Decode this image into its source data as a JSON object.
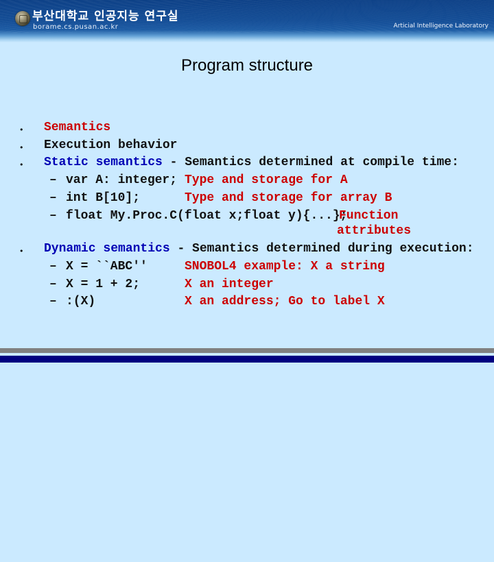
{
  "header": {
    "institution": "부산대학교 인공지능 연구실",
    "url": "borame.cs.pusan.ac.kr",
    "lab_name": "Articial Intelligence Laboratory",
    "emblem_icon": "university-seal-icon"
  },
  "slide": {
    "title": "Program structure",
    "bullets": [
      {
        "parts": [
          {
            "text": "Semantics",
            "color": "red"
          }
        ]
      },
      {
        "parts": [
          {
            "text": "Execution behavior",
            "color": "black"
          }
        ]
      },
      {
        "parts": [
          {
            "text": "Static semantics",
            "color": "blue"
          },
          {
            "text": " - Semantics determined at compile time:",
            "color": "black"
          }
        ],
        "sub": [
          {
            "code": "var A: integer;",
            "note": "Type and storage for A"
          },
          {
            "code": "int B[10];",
            "note": "Type and storage for array B"
          },
          {
            "code": "float My.Proc.C(float x;float y){...};",
            "note": "Function",
            "note_cont": "attributes"
          }
        ]
      },
      {
        "parts": [
          {
            "text": "Dynamic semantics",
            "color": "blue"
          },
          {
            "text": " - Semantics determined during execution:",
            "color": "black"
          }
        ],
        "sub": [
          {
            "code": "X = ``ABC''",
            "note": "SNOBOL4 example: X a string"
          },
          {
            "code": "X = 1 + 2;",
            "note": "X an integer"
          },
          {
            "code": ":(X)",
            "note": "X an address; Go to label X"
          }
        ]
      }
    ],
    "bullet_glyph": "•",
    "dash_glyph": "–"
  },
  "colors": {
    "red": "#cc0000",
    "blue": "#0000b4",
    "black": "#111111",
    "background": "#cbeaff",
    "header_blue": "#114b95",
    "bar_gray": "#808080",
    "bar_navy": "#000080"
  }
}
